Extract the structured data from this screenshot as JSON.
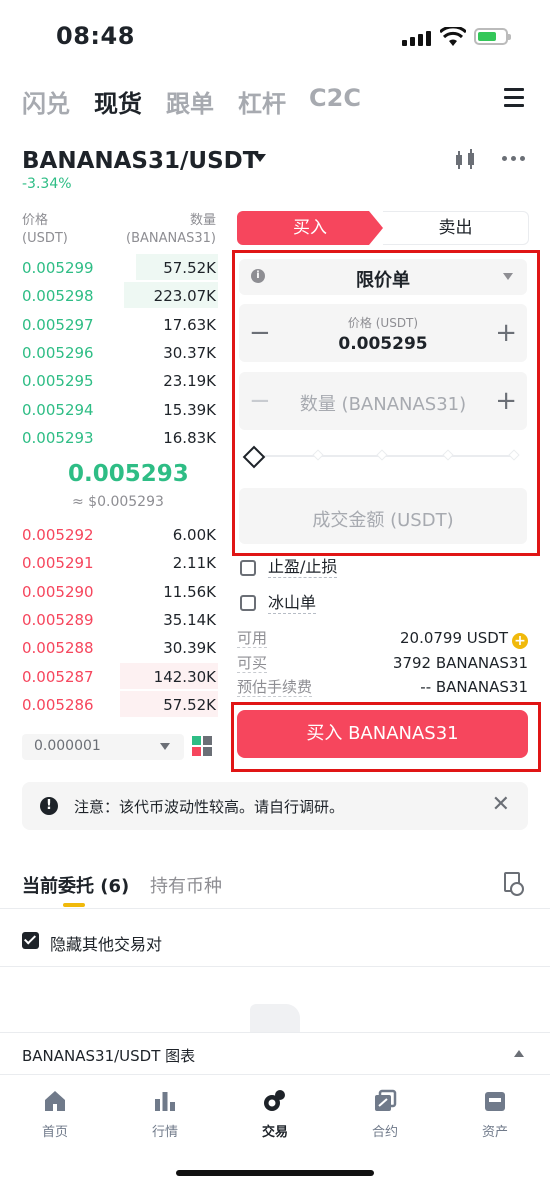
{
  "status_bar": {
    "time": "08:48"
  },
  "top_tabs": [
    "闪兑",
    "现货",
    "跟单",
    "杠杆",
    "C2C"
  ],
  "pair": {
    "symbol": "BANANAS31/USDT",
    "change": "-3.34%"
  },
  "order_book": {
    "price_header": [
      "价格",
      "(USDT)"
    ],
    "qty_header": [
      "数量",
      "(BANANAS31)"
    ],
    "bids": [
      {
        "price": "0.005299",
        "qty": "57.52K",
        "depth": 0.42
      },
      {
        "price": "0.005298",
        "qty": "223.07K",
        "depth": 0.48
      },
      {
        "price": "0.005297",
        "qty": "17.63K",
        "depth": 0.0
      },
      {
        "price": "0.005296",
        "qty": "30.37K",
        "depth": 0.0
      },
      {
        "price": "0.005295",
        "qty": "23.19K",
        "depth": 0.0
      },
      {
        "price": "0.005294",
        "qty": "15.39K",
        "depth": 0.0
      },
      {
        "price": "0.005293",
        "qty": "16.83K",
        "depth": 0.0
      }
    ],
    "mid_price": "0.005293",
    "mid_usd": "≈ $0.005293",
    "asks": [
      {
        "price": "0.005292",
        "qty": "6.00K",
        "depth": 0.0
      },
      {
        "price": "0.005291",
        "qty": "2.11K",
        "depth": 0.0
      },
      {
        "price": "0.005290",
        "qty": "11.56K",
        "depth": 0.0
      },
      {
        "price": "0.005289",
        "qty": "35.14K",
        "depth": 0.0
      },
      {
        "price": "0.005288",
        "qty": "30.39K",
        "depth": 0.0
      },
      {
        "price": "0.005287",
        "qty": "142.30K",
        "depth": 0.5
      },
      {
        "price": "0.005286",
        "qty": "57.52K",
        "depth": 0.5
      }
    ],
    "precision": "0.000001"
  },
  "trade": {
    "buy_tab": "买入",
    "sell_tab": "卖出",
    "order_type": "限价单",
    "price_label": "价格 (USDT)",
    "price_value": "0.005295",
    "amount_placeholder": "数量 (BANANAS31)",
    "slider_percent": 0,
    "total_placeholder": "成交金额 (USDT)",
    "tpsl_label": "止盈/止损",
    "iceberg_label": "冰山单",
    "available_label": "可用",
    "available_value": "20.0799 USDT",
    "can_buy_label": "可买",
    "can_buy_value": "3792 BANANAS31",
    "fee_label": "预估手续费",
    "fee_value": "-- BANANAS31",
    "buy_button": "买入 BANANAS31"
  },
  "notice": {
    "text": "注意：该代币波动性较高。请自行调研。"
  },
  "orders": {
    "tab_open": "当前委托 (6)",
    "tab_holdings": "持有币种",
    "hide_others": "隐藏其他交易对"
  },
  "chart_bar": {
    "label": "BANANAS31/USDT 图表"
  },
  "bottom_nav": [
    "首页",
    "行情",
    "交易",
    "合约",
    "资产"
  ],
  "colors": {
    "buy": "#2ebd85",
    "sell": "#f6465d",
    "accent": "#f0b90b",
    "highlight": "#e01515"
  }
}
